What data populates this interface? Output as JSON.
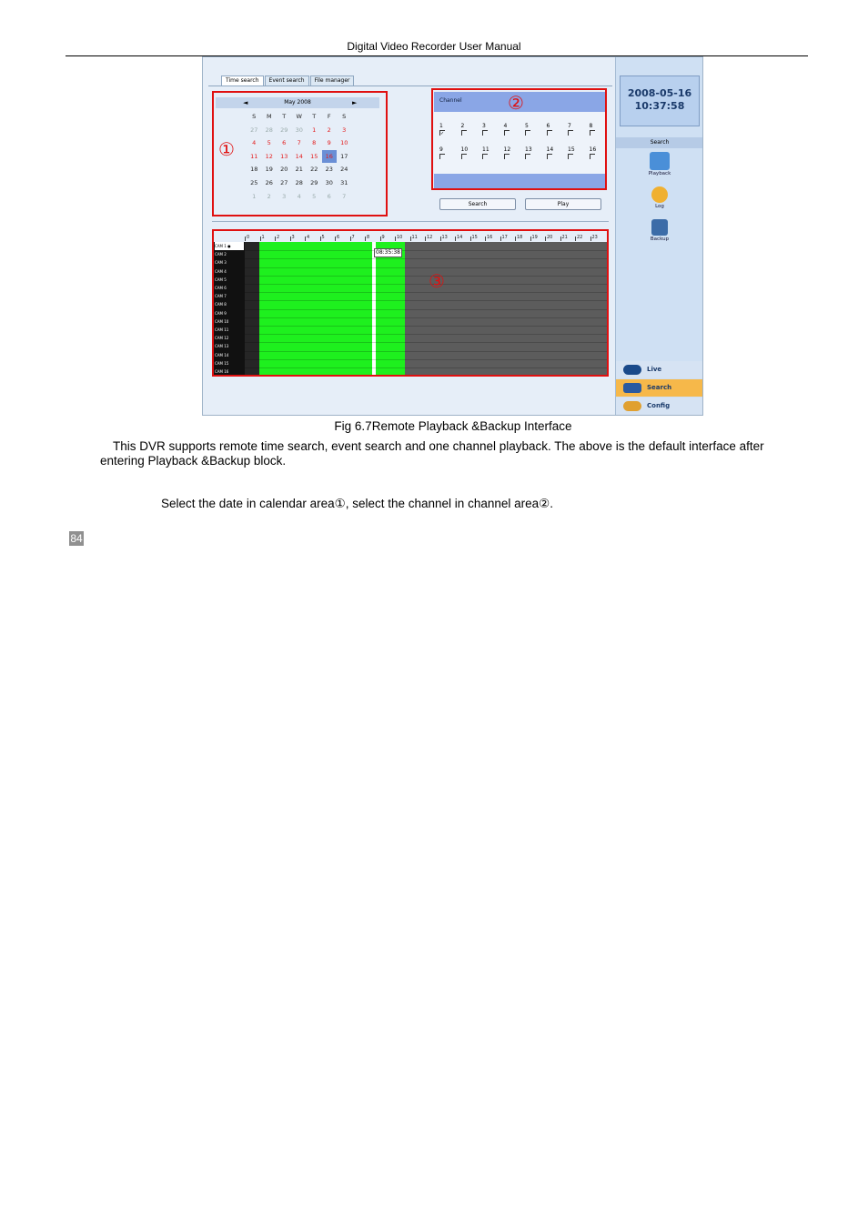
{
  "header": {
    "title": "Digital Video Recorder User Manual"
  },
  "figure": {
    "tabs": [
      "Time search",
      "Event search",
      "File manager"
    ],
    "calendar": {
      "month": "May 2008",
      "prev": "◄",
      "next": "►",
      "weekdays": [
        "S",
        "M",
        "T",
        "W",
        "T",
        "F",
        "S"
      ],
      "days": [
        "27",
        "28",
        "29",
        "30",
        "1",
        "2",
        "3",
        "4",
        "5",
        "6",
        "7",
        "8",
        "9",
        "10",
        "11",
        "12",
        "13",
        "14",
        "15",
        "16",
        "17",
        "18",
        "19",
        "20",
        "21",
        "22",
        "23",
        "24",
        "25",
        "26",
        "27",
        "28",
        "29",
        "30",
        "31",
        "1",
        "2",
        "3",
        "4",
        "5",
        "6",
        "7"
      ],
      "selected": "16"
    },
    "markers": {
      "m1": "①",
      "m2": "②",
      "m3": "③"
    },
    "channel": {
      "title": "Channel",
      "row1": [
        "1",
        "2",
        "3",
        "4",
        "5",
        "6",
        "7",
        "8"
      ],
      "row2": [
        "9",
        "10",
        "11",
        "12",
        "13",
        "14",
        "15",
        "16"
      ],
      "checked": [
        "1"
      ]
    },
    "buttons": {
      "search": "Search",
      "play": "Play"
    },
    "timeline": {
      "hours": [
        "0",
        "1",
        "2",
        "3",
        "4",
        "5",
        "6",
        "7",
        "8",
        "9",
        "10",
        "11",
        "12",
        "13",
        "14",
        "15",
        "16",
        "17",
        "18",
        "19",
        "20",
        "21",
        "22",
        "23"
      ],
      "cameras": [
        "CAM 1",
        "CAM 2",
        "CAM 3",
        "CAM 4",
        "CAM 5",
        "CAM 6",
        "CAM 7",
        "CAM 8",
        "CAM 9",
        "CAM 10",
        "CAM 11",
        "CAM 12",
        "CAM 13",
        "CAM 14",
        "CAM 15",
        "CAM 16"
      ],
      "time_tag": "08:35:38"
    },
    "sidebar": {
      "date": "2008-05-16",
      "time": "10:37:58",
      "search_label": "Search",
      "items": [
        "Playback",
        "Log",
        "Backup"
      ],
      "nav": [
        "Live",
        "Search",
        "Config"
      ]
    }
  },
  "caption": "Fig 6.7Remote Playback &Backup Interface",
  "paragraph": "This DVR supports remote time search, event search and one channel playback. The above is the default interface after entering Playback &Backup block.",
  "paragraph2": "Select the date in calendar area①, select the channel in channel area②.",
  "page_number": "84"
}
